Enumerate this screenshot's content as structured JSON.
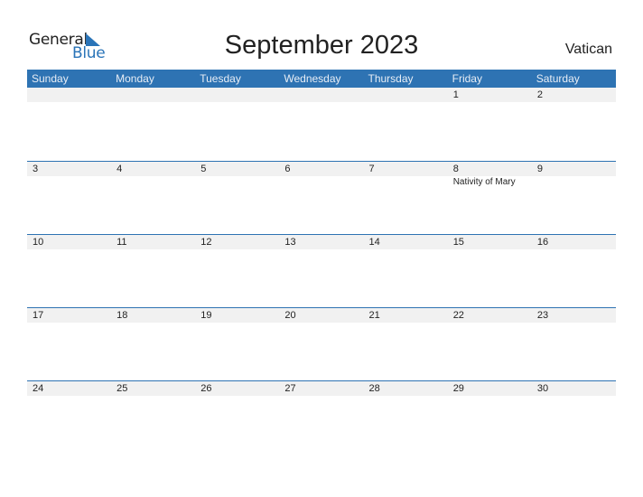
{
  "logo": {
    "word1": "General",
    "word2": "Blue"
  },
  "title": "September 2023",
  "country": "Vatican",
  "colors": {
    "accent": "#2e73b3",
    "date_strip": "#f1f1f1"
  },
  "weekdays": [
    "Sunday",
    "Monday",
    "Tuesday",
    "Wednesday",
    "Thursday",
    "Friday",
    "Saturday"
  ],
  "weeks": [
    [
      {
        "day": ""
      },
      {
        "day": ""
      },
      {
        "day": ""
      },
      {
        "day": ""
      },
      {
        "day": ""
      },
      {
        "day": "1"
      },
      {
        "day": "2"
      }
    ],
    [
      {
        "day": "3"
      },
      {
        "day": "4"
      },
      {
        "day": "5"
      },
      {
        "day": "6"
      },
      {
        "day": "7"
      },
      {
        "day": "8",
        "event": "Nativity of Mary"
      },
      {
        "day": "9"
      }
    ],
    [
      {
        "day": "10"
      },
      {
        "day": "11"
      },
      {
        "day": "12"
      },
      {
        "day": "13"
      },
      {
        "day": "14"
      },
      {
        "day": "15"
      },
      {
        "day": "16"
      }
    ],
    [
      {
        "day": "17"
      },
      {
        "day": "18"
      },
      {
        "day": "19"
      },
      {
        "day": "20"
      },
      {
        "day": "21"
      },
      {
        "day": "22"
      },
      {
        "day": "23"
      }
    ],
    [
      {
        "day": "24"
      },
      {
        "day": "25"
      },
      {
        "day": "26"
      },
      {
        "day": "27"
      },
      {
        "day": "28"
      },
      {
        "day": "29"
      },
      {
        "day": "30"
      }
    ]
  ]
}
